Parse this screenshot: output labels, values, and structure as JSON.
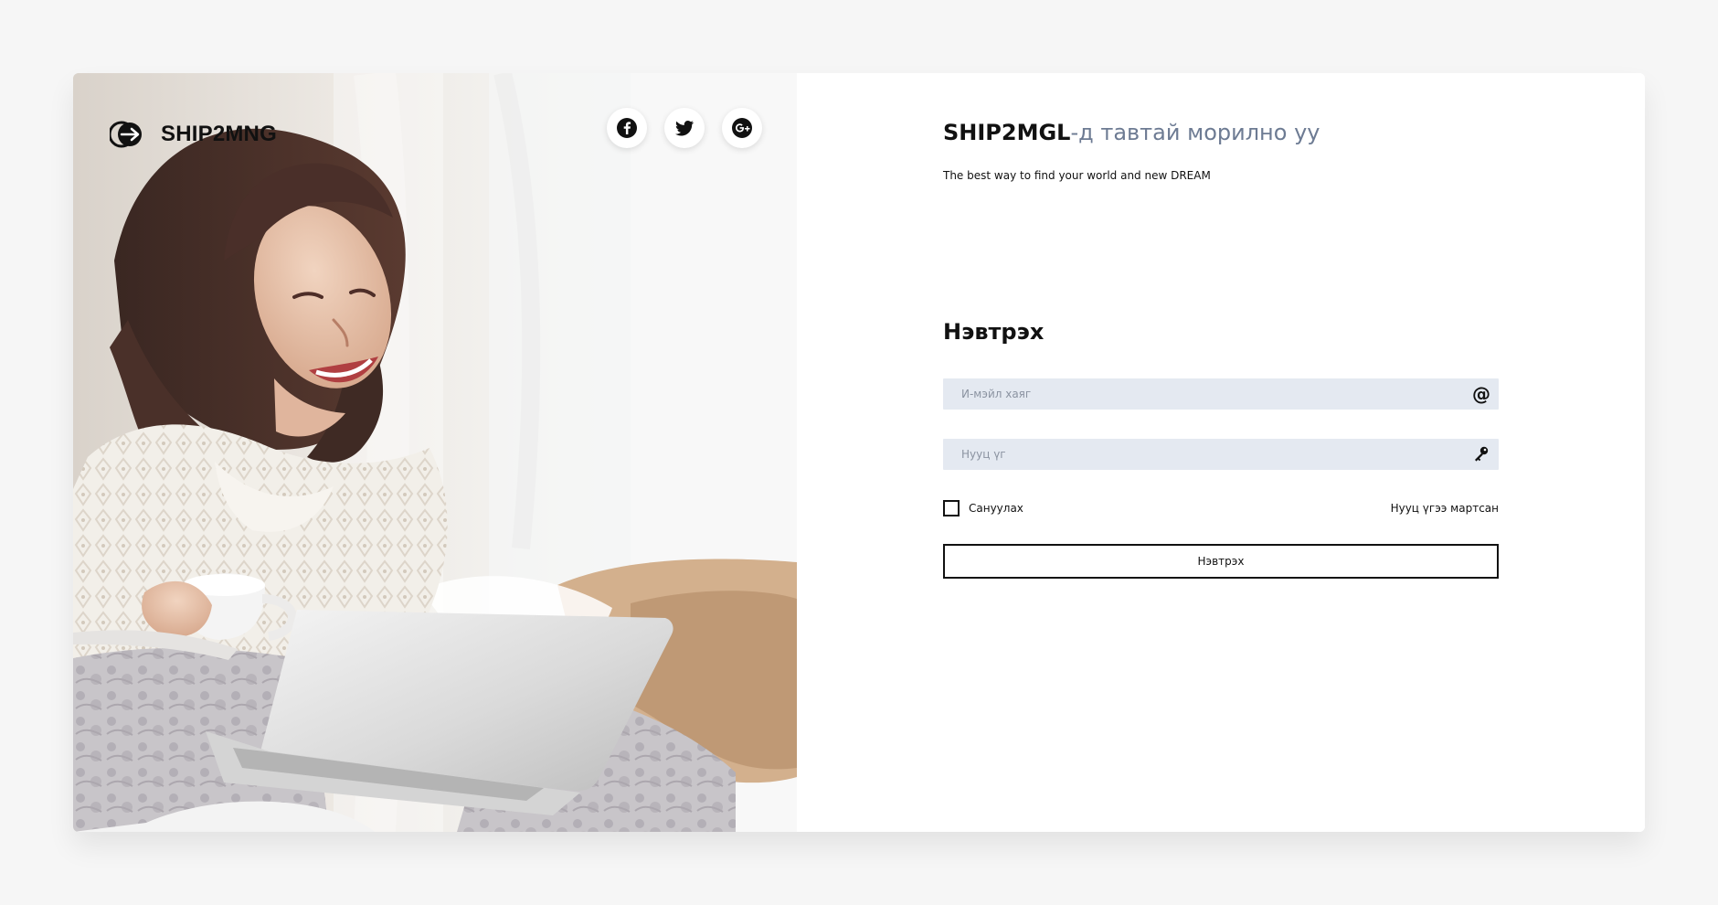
{
  "brand": {
    "name": "SHIP2MNG"
  },
  "social": {
    "facebook_icon": "facebook-icon",
    "twitter_icon": "twitter-icon",
    "google_plus_icon": "google-plus-icon"
  },
  "welcome": {
    "brand": "SHIP2MGL",
    "suffix": "-д тавтай морилно уу",
    "tagline": "The best way to find your world and new DREAM"
  },
  "login": {
    "title": "Нэвтрэх",
    "email_placeholder": "И-мэйл хаяг",
    "email_icon": "@",
    "password_placeholder": "Нууц үг",
    "password_icon": "key-icon",
    "remember_label": "Сануулах",
    "forgot_label": "Нууц үгээ мартсан",
    "submit_label": "Нэвтрэх"
  },
  "colors": {
    "page_background": "#f6f6f6",
    "input_background": "#e4e9f1",
    "muted_text": "#6d7b93",
    "primary_text": "#111111"
  }
}
